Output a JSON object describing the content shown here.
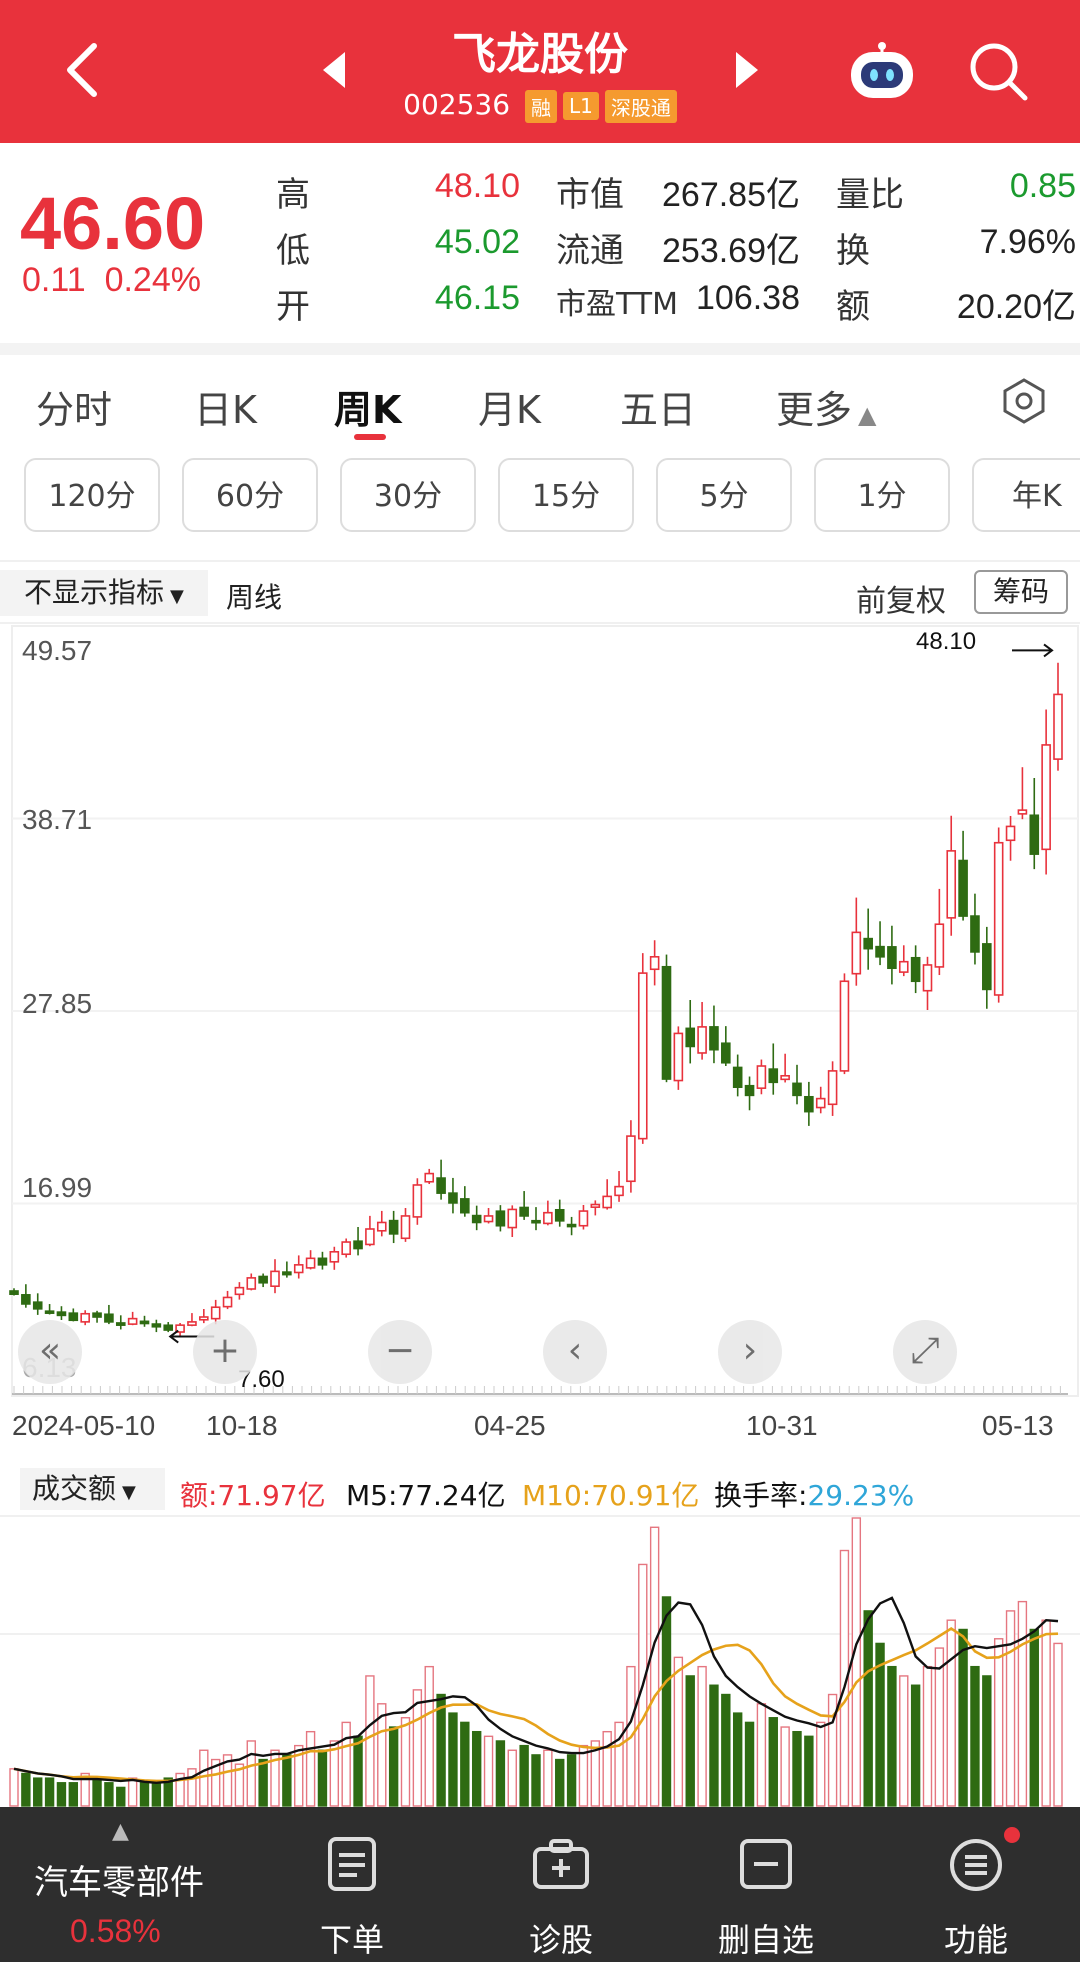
{
  "header": {
    "stock_name": "飞龙股份",
    "stock_code": "002536",
    "tags": [
      "融",
      "L1",
      "深股通"
    ]
  },
  "quote": {
    "price": "46.60",
    "change": "0.11",
    "change_pct": "0.24%",
    "high_label": "高",
    "high": "48.10",
    "low_label": "低",
    "low": "45.02",
    "open_label": "开",
    "open": "46.15",
    "mktcap_label": "市值",
    "mktcap": "267.85亿",
    "float_label": "流通",
    "float": "253.69亿",
    "pe_label": "市盈TTM",
    "pe": "106.38",
    "volratio_label": "量比",
    "volratio": "0.85",
    "turnover_label": "换",
    "turnover": "7.96%",
    "amount_label": "额",
    "amount": "20.20亿"
  },
  "tabs": [
    "分时",
    "日K",
    "周K",
    "月K",
    "五日",
    "更多"
  ],
  "active_tab": "周K",
  "period_buttons": [
    "120分",
    "60分",
    "30分",
    "15分",
    "5分",
    "1分",
    "年K"
  ],
  "indicator": {
    "selector": "不显示指标",
    "chart_label": "周线",
    "adjust": "前复权",
    "chips": "筹码"
  },
  "chart_data": {
    "type": "candlestick",
    "y_ticks": [
      "49.57",
      "38.71",
      "27.85",
      "16.99",
      "6.13"
    ],
    "ylim": [
      6.13,
      49.57
    ],
    "x_ticks": [
      "2024-05-10",
      "10-18",
      "04-25",
      "10-31",
      "05-13"
    ],
    "max_marker": "48.10",
    "min_marker": "7.60",
    "closes": [
      9.8,
      9.2,
      8.9,
      8.7,
      8.5,
      8.2,
      8.6,
      8.4,
      8.1,
      7.9,
      8.3,
      8.0,
      7.8,
      7.6,
      7.9,
      8.1,
      8.4,
      9.0,
      9.6,
      10.2,
      10.8,
      10.5,
      11.2,
      11.0,
      11.6,
      12.0,
      11.6,
      12.4,
      13.0,
      12.6,
      13.8,
      14.2,
      13.5,
      14.6,
      16.5,
      17.2,
      16.0,
      15.4,
      14.8,
      14.2,
      14.6,
      14.0,
      15.0,
      14.6,
      14.2,
      14.8,
      14.3,
      14.0,
      14.9,
      15.3,
      15.8,
      16.4,
      19.5,
      29.5,
      30.5,
      23.0,
      25.8,
      25.0,
      26.2,
      24.8,
      24.0,
      22.5,
      22.0,
      23.8,
      22.8,
      23.2,
      22.0,
      21.0,
      21.8,
      23.5,
      29.0,
      32.0,
      31.0,
      30.5,
      29.8,
      30.2,
      29.0,
      30.0,
      32.5,
      37.0,
      33.0,
      30.8,
      28.5,
      37.5,
      38.5,
      39.5,
      36.8,
      43.5,
      46.6
    ],
    "volume_label": "成交额",
    "amount": "额:71.97亿",
    "m5": "M5:77.24亿",
    "m10": "M10:70.91亿",
    "turnover_rate_label": "换手率:",
    "turnover_rate": "29.23%",
    "volumes": [
      8,
      7,
      6,
      6,
      5,
      5,
      7,
      6,
      5,
      4,
      6,
      5,
      5,
      6,
      7,
      8,
      12,
      10,
      11,
      9,
      14,
      10,
      12,
      11,
      13,
      16,
      12,
      14,
      18,
      15,
      28,
      22,
      17,
      19,
      25,
      30,
      24,
      20,
      18,
      16,
      15,
      14,
      12,
      13,
      11,
      12,
      10,
      11,
      13,
      14,
      16,
      18,
      30,
      52,
      60,
      45,
      32,
      28,
      30,
      26,
      24,
      20,
      18,
      22,
      19,
      17,
      16,
      15,
      18,
      24,
      55,
      62,
      42,
      35,
      30,
      28,
      26,
      30,
      34,
      40,
      38,
      30,
      28,
      36,
      42,
      44,
      38,
      40,
      35
    ],
    "colors": {
      "up": "#e8323c",
      "down": "#2e6b12",
      "m5": "#111111",
      "m10": "#e6a21b"
    }
  },
  "footer": {
    "sector_name": "汽车零部件",
    "sector_change": "0.58%",
    "items": [
      "下单",
      "诊股",
      "删自选",
      "功能"
    ]
  }
}
